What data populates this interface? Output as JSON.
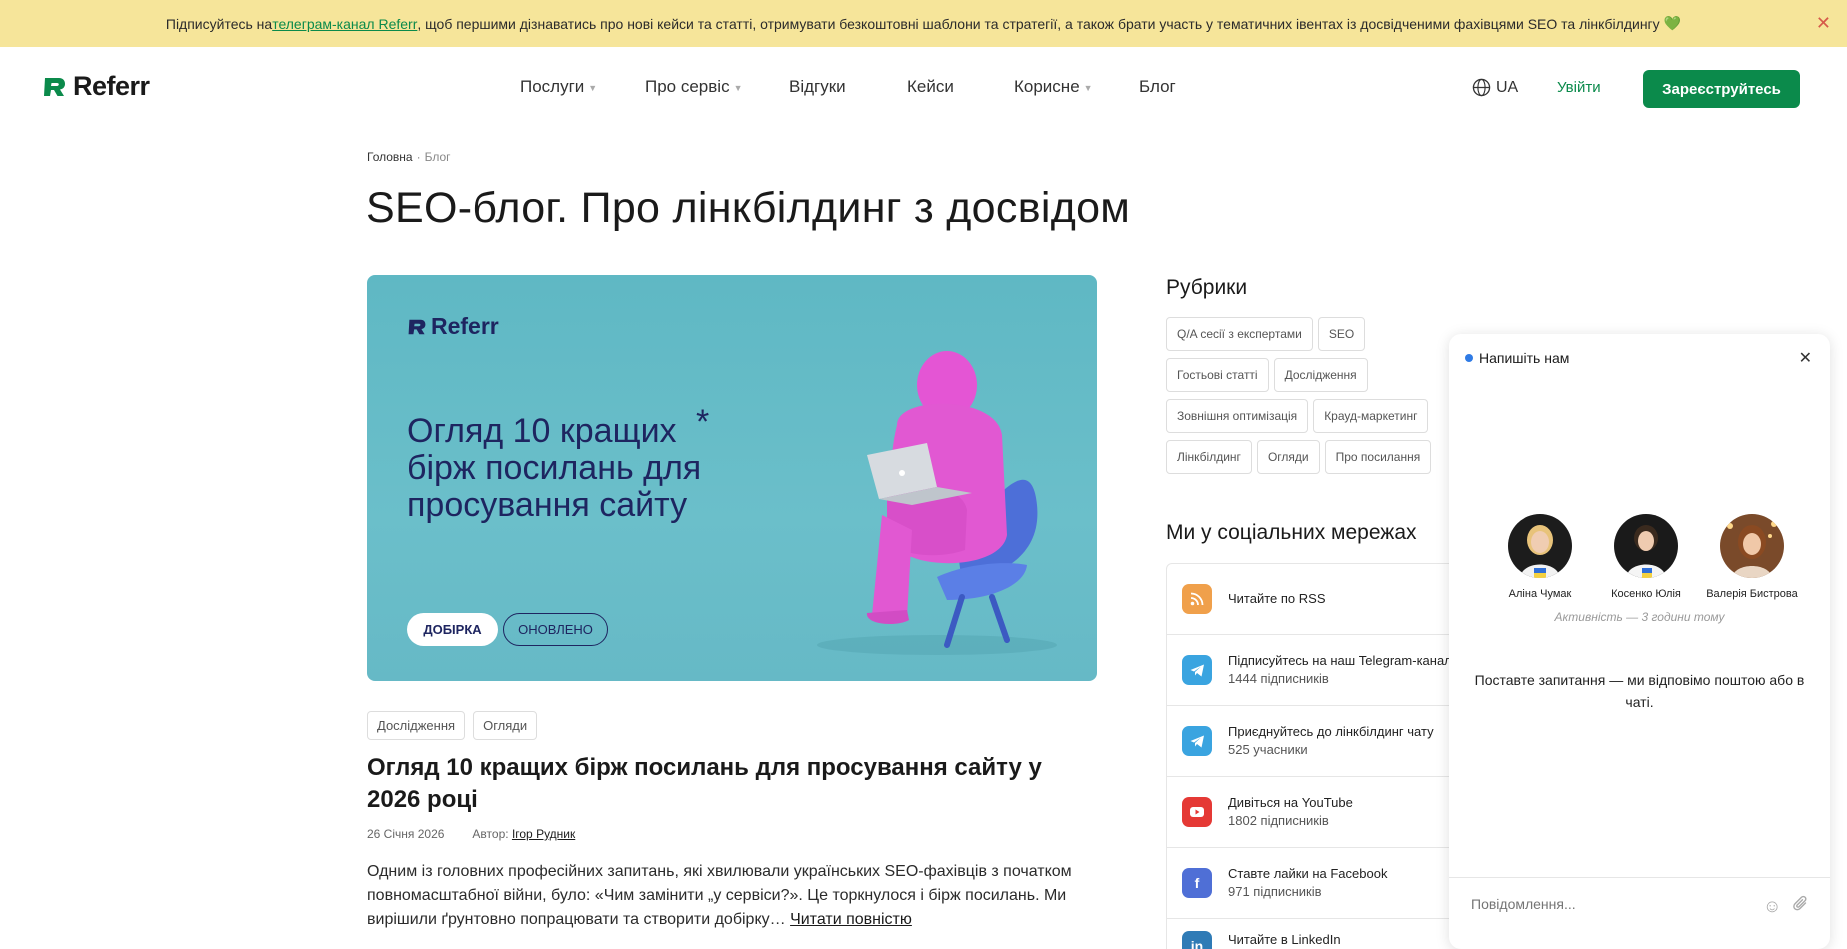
{
  "announcement": {
    "before": "Підписуйтесь на ",
    "link": "телеграм-канал Referr",
    "after": ", щоб першими дізнаватись про нові кейси та статті, отримувати безкоштовні шаблони та стратегії, а також брати участь у тематичних івентах із досвідченими фахівцями SEO та лінкбілдингу"
  },
  "header": {
    "logo_text": "Referr",
    "nav": [
      {
        "label": "Послуги",
        "dropdown": true
      },
      {
        "label": "Про сервіс",
        "dropdown": true
      },
      {
        "label": "Відгуки",
        "dropdown": false
      },
      {
        "label": "Кейси",
        "dropdown": false
      },
      {
        "label": "Корисне",
        "dropdown": true
      },
      {
        "label": "Блог",
        "dropdown": false
      }
    ],
    "lang": "UA",
    "login": "Увійти",
    "signup": "Зареєструйтесь"
  },
  "breadcrumb": {
    "home": "Головна",
    "current": "Блог"
  },
  "page_title": "SEO-блог. Про лінкбілдинг з досвідом",
  "hero": {
    "logo_text": "Referr",
    "headline": "Огляд 10 кращих бірж посилань для просування сайту",
    "asterisk": "*",
    "badge_1": "ДОБІРКА",
    "badge_2": "ОНОВЛЕНО"
  },
  "post": {
    "tags": [
      "Дослідження",
      "Огляди"
    ],
    "title": "Огляд 10 кращих бірж посилань для просування сайту у 2026 році",
    "date": "26 Січня 2026",
    "author_label": "Автор:",
    "author": "Ігор Рудник",
    "excerpt": "Одним із головних професійних запитань, які хвилювали українських SEO-фахівців з початком повномасштабної війни, було: «Чим замінити „у сервіси?». Це торкнулося і бірж посилань. Ми вирішили ґрунтовно попрацювати та створити добірку…",
    "read_more": "Читати повністю"
  },
  "sidebar": {
    "rubrics_title": "Рубрики",
    "rubrics": [
      "Q/A сесії з експертами",
      "SEO",
      "Гостьові статті",
      "Дослідження",
      "Зовнішня оптимізація",
      "Крауд-маркетинг",
      "Лінкбілдинг",
      "Огляди",
      "Про посилання"
    ],
    "social_title": "Ми у соціальних мережах",
    "social": [
      {
        "label": "Читайте по RSS",
        "sub": "",
        "icon": "rss-icon",
        "color": "#f0a04b"
      },
      {
        "label": "Підписуйтесь на наш Telegram-канал",
        "sub": "1444 підписників",
        "icon": "telegram-icon",
        "color": "#3aa4e0"
      },
      {
        "label": "Приєднуйтесь до лінкбілдинг чату",
        "sub": "525 учасники",
        "icon": "telegram-icon",
        "color": "#3aa4e0"
      },
      {
        "label": "Дивіться на YouTube",
        "sub": "1802 підписників",
        "icon": "youtube-icon",
        "color": "#e53935"
      },
      {
        "label": "Ставте лайки на Facebook",
        "sub": "971 підписників",
        "icon": "facebook-icon",
        "color": "#4f6fd6"
      },
      {
        "label": "Читайте в LinkedIn",
        "sub": "",
        "icon": "linkedin-icon",
        "color": "#2f7bb6"
      }
    ]
  },
  "chat": {
    "title": "Напишіть нам",
    "agents": [
      {
        "name": "Аліна Чумак"
      },
      {
        "name": "Косенко Юлія"
      },
      {
        "name": "Валерія Бистрова"
      }
    ],
    "activity": "Активність — 3 години тому",
    "message": "Поставте запитання — ми відповімо поштою або в чаті.",
    "input_placeholder": "Повідомлення..."
  },
  "colors": {
    "brand_green": "#0b8a4b",
    "announce_bg": "#f6e59a",
    "hero_bg": "#64bac6",
    "hero_text": "#1e2560"
  }
}
